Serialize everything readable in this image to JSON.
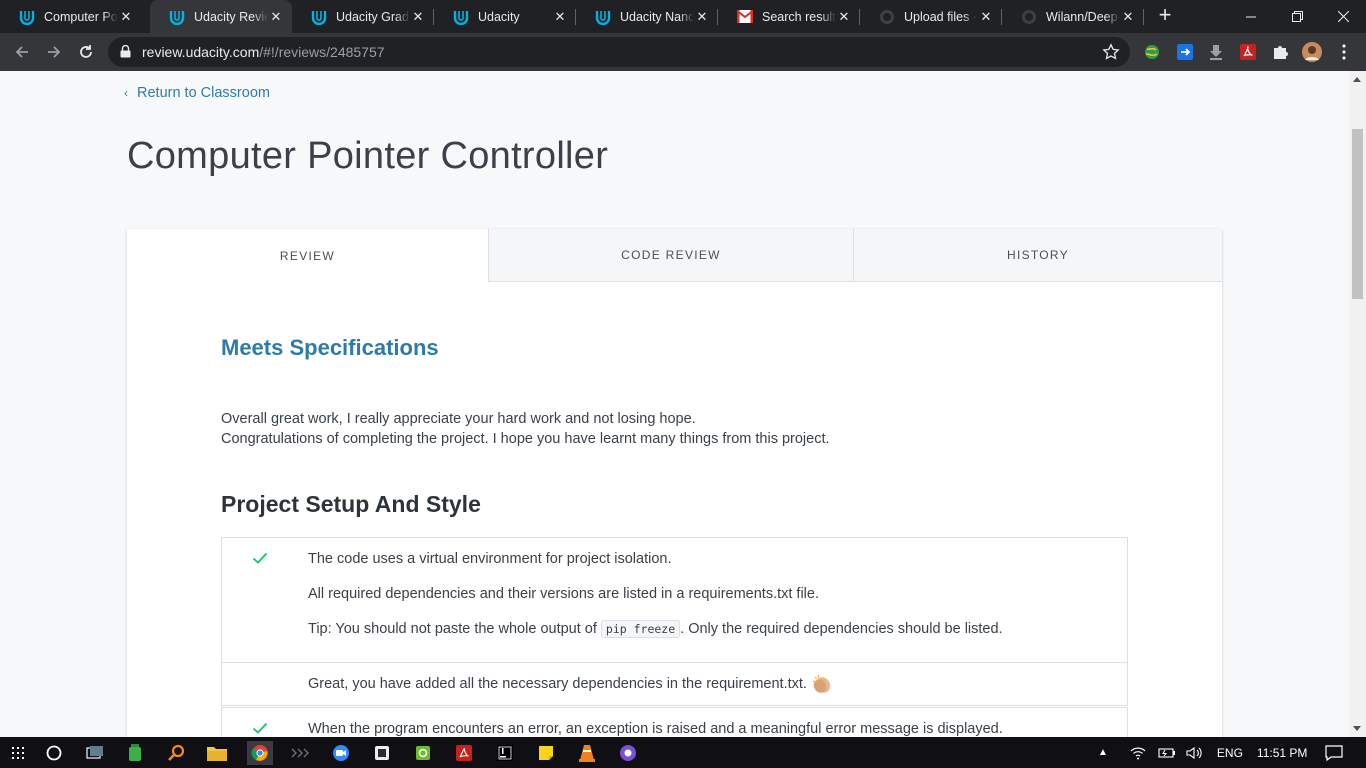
{
  "browser": {
    "tabs": [
      {
        "title": "Computer Pointer Controller",
        "icon": "udacity-icon",
        "active": false
      },
      {
        "title": "Udacity Reviews",
        "icon": "udacity-icon",
        "active": true
      },
      {
        "title": "Udacity Graduation",
        "icon": "udacity-icon",
        "active": false
      },
      {
        "title": "Udacity",
        "icon": "udacity-icon",
        "active": false
      },
      {
        "title": "Udacity Nanodegree",
        "icon": "udacity-icon",
        "active": false
      },
      {
        "title": "Search results",
        "icon": "gmail-icon",
        "active": false
      },
      {
        "title": "Upload files · intel",
        "icon": "github-icon",
        "active": false
      },
      {
        "title": "Wilann/Deep-Learning",
        "icon": "github-icon",
        "active": false
      }
    ],
    "url_host": "review.udacity.com",
    "url_path": "/#!/reviews/2485757"
  },
  "page": {
    "return_link": "Return to Classroom",
    "title": "Computer Pointer Controller",
    "tabs": [
      "REVIEW",
      "CODE REVIEW",
      "HISTORY"
    ],
    "result": "Meets Specifications",
    "overall_comment_line1": "Overall great work, I really appreciate your hard work and not losing hope.",
    "overall_comment_line2": "Congratulations of completing the project. I hope you have learnt many things from this project.",
    "section_title": "Project Setup And Style",
    "rubric": [
      {
        "spec_line1": "The code uses a virtual environment for project isolation.",
        "spec_line2": "All required dependencies and their versions are listed in a requirements.txt file.",
        "spec_tip_before": "Tip: You should not paste the whole output of ",
        "spec_tip_code": "pip freeze",
        "spec_tip_after": ". Only the required dependencies should be listed.",
        "comment": "Great, you have added all the necessary dependencies in the requirement.txt.",
        "status": "meets"
      },
      {
        "spec_line1": "When the program encounters an error, an exception is raised and a meaningful error message is displayed.",
        "status": "meets"
      }
    ]
  },
  "taskbar": {
    "language": "ENG",
    "time": "11:51 PM"
  },
  "colors": {
    "accent": "#2e7ba8",
    "check": "#02b3e4",
    "success": "#15c26b"
  }
}
